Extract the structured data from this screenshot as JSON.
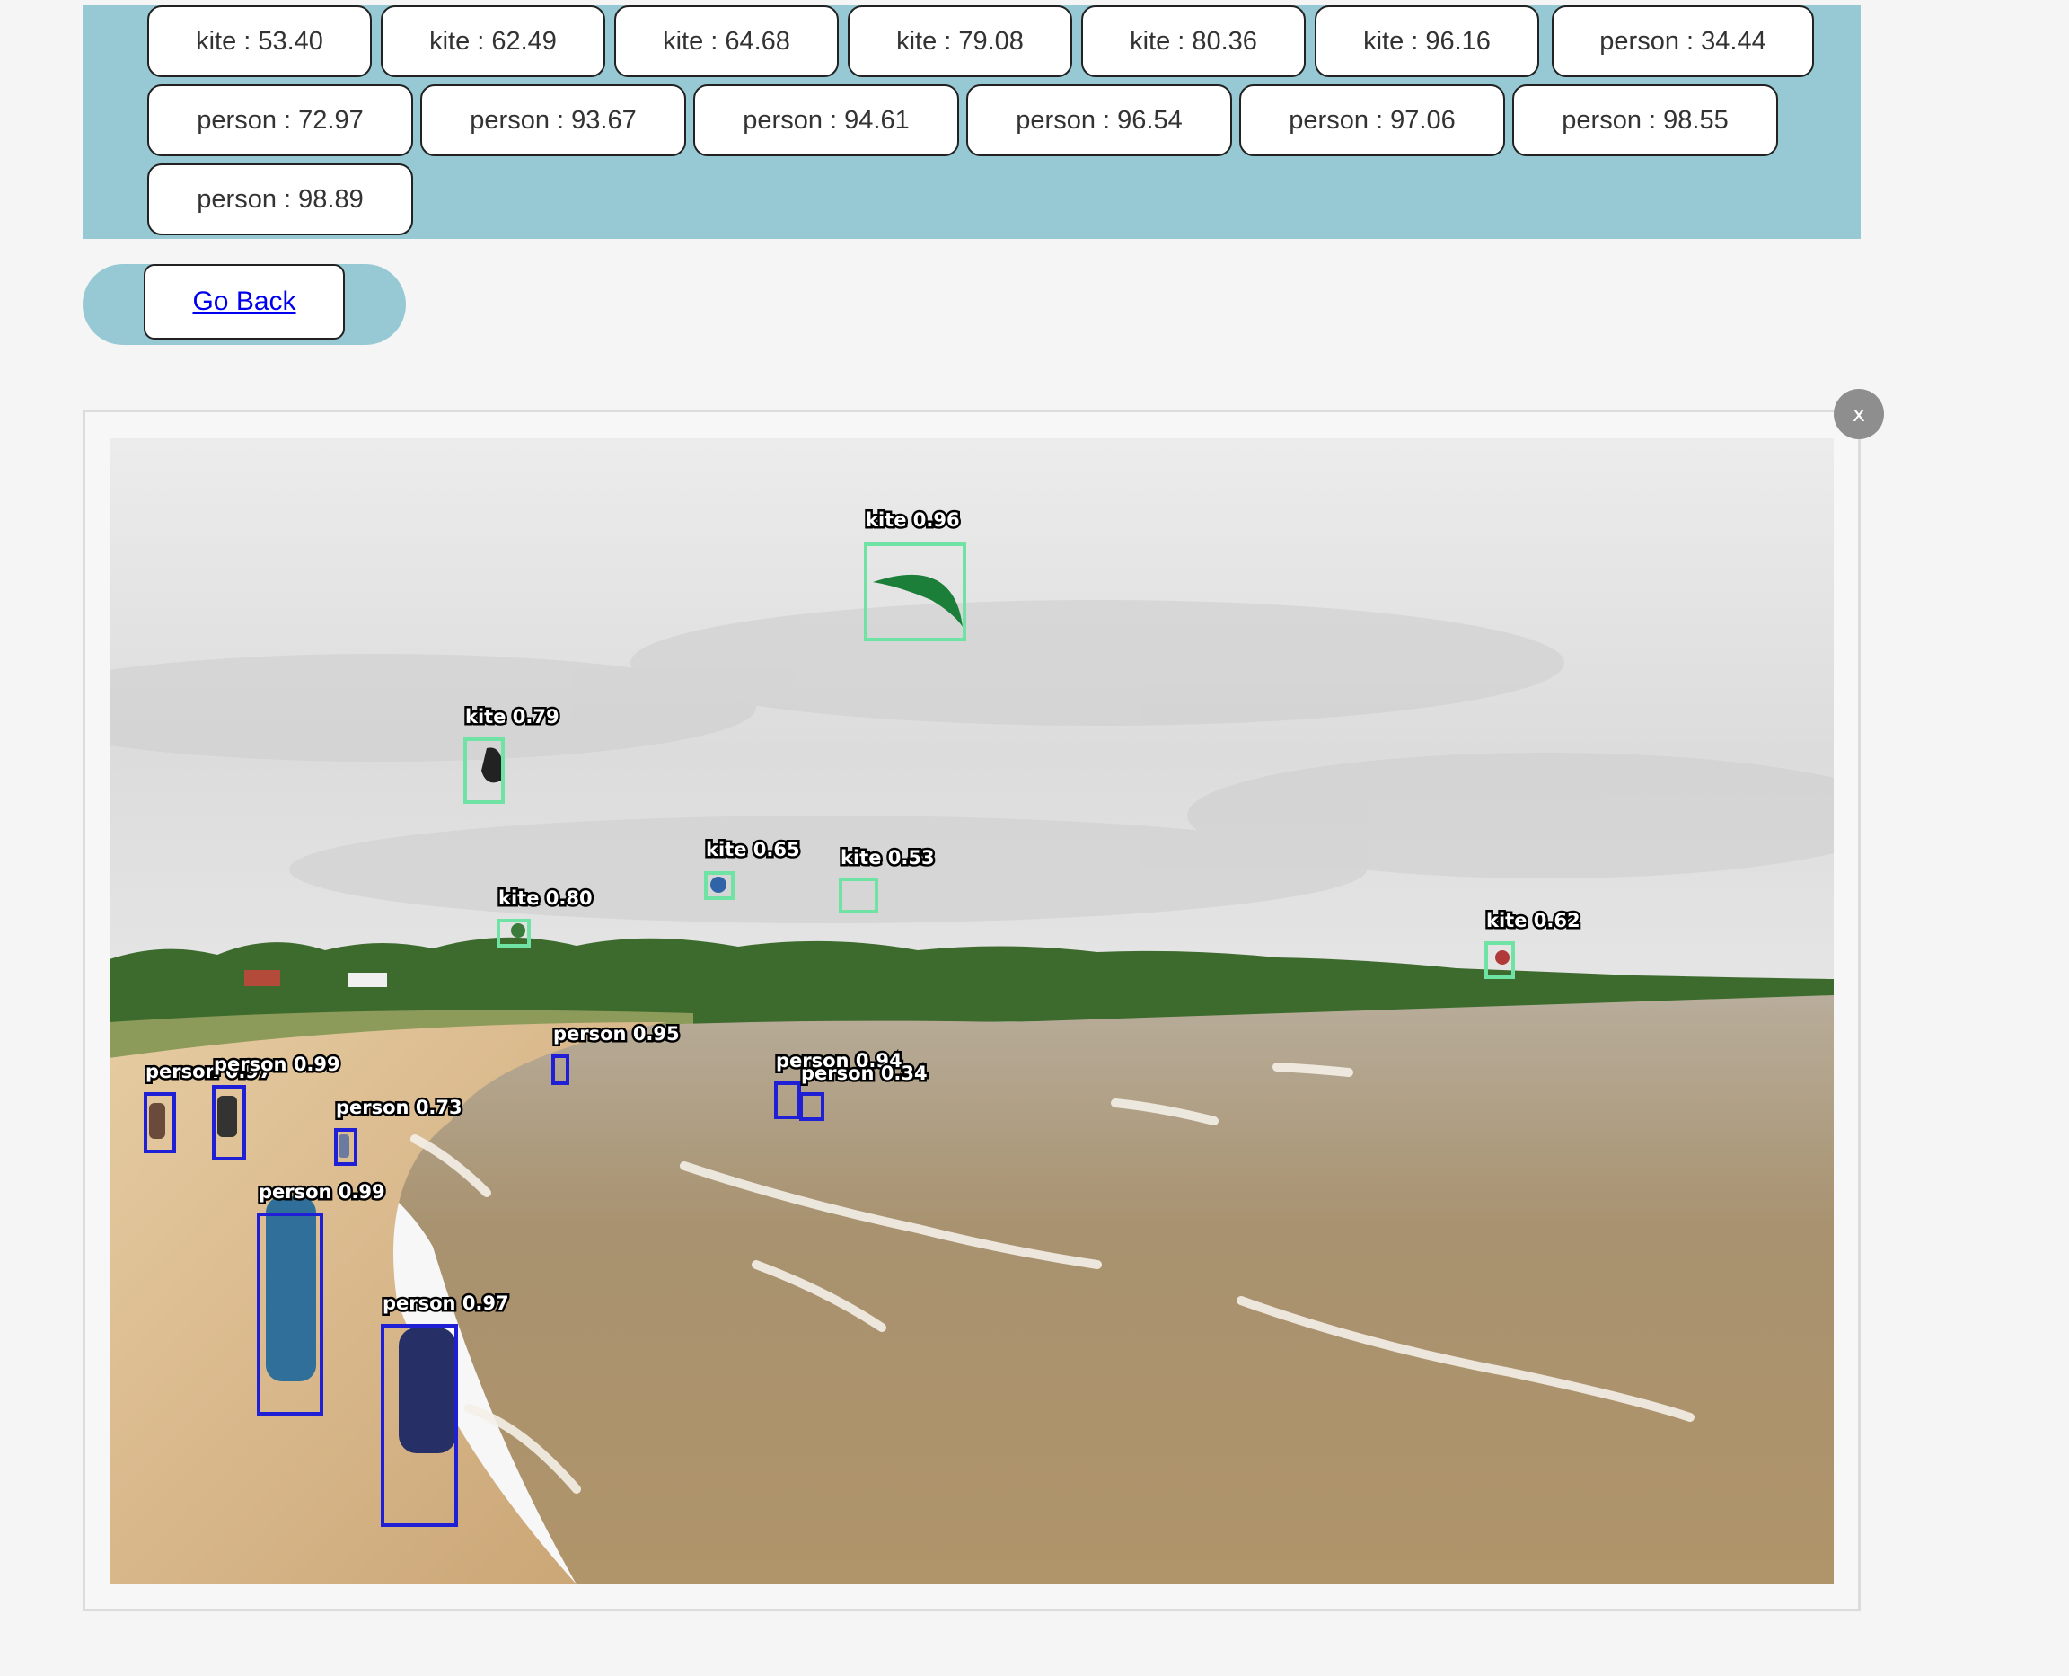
{
  "detections": [
    {
      "label": "kite : 53.40"
    },
    {
      "label": "kite : 62.49"
    },
    {
      "label": "kite : 64.68"
    },
    {
      "label": "kite : 79.08"
    },
    {
      "label": "kite : 80.36"
    },
    {
      "label": "kite : 96.16"
    },
    {
      "label": "person : 34.44"
    },
    {
      "label": "person : 72.97"
    },
    {
      "label": "person : 93.67"
    },
    {
      "label": "person : 94.61"
    },
    {
      "label": "person : 96.54"
    },
    {
      "label": "person : 97.06"
    },
    {
      "label": "person : 98.55"
    },
    {
      "label": "person : 98.89"
    }
  ],
  "nav": {
    "go_back": "Go Back"
  },
  "modal": {
    "close_label": "x"
  },
  "image_overlays": {
    "boxes": [
      {
        "class": "kite",
        "text": "kite 0.96"
      },
      {
        "class": "kite",
        "text": "kite 0.79"
      },
      {
        "class": "kite",
        "text": "kite 0.65"
      },
      {
        "class": "kite",
        "text": "kite 0.53"
      },
      {
        "class": "kite",
        "text": "kite 0.80"
      },
      {
        "class": "kite",
        "text": "kite 0.62"
      },
      {
        "class": "person",
        "text": "person 0.95"
      },
      {
        "class": "person",
        "text": "person 0.94"
      },
      {
        "class": "person",
        "text": "person 0.34"
      },
      {
        "class": "person",
        "text": "person 0.97"
      },
      {
        "class": "person",
        "text": "person 0.99"
      },
      {
        "class": "person",
        "text": "person 0.73"
      },
      {
        "class": "person",
        "text": "person 0.99"
      },
      {
        "class": "person",
        "text": "person 0.97"
      }
    ]
  },
  "colors": {
    "panel": "#96c9d3",
    "kite_box": "#6fe3a3",
    "person_box": "#1f1fd6"
  }
}
